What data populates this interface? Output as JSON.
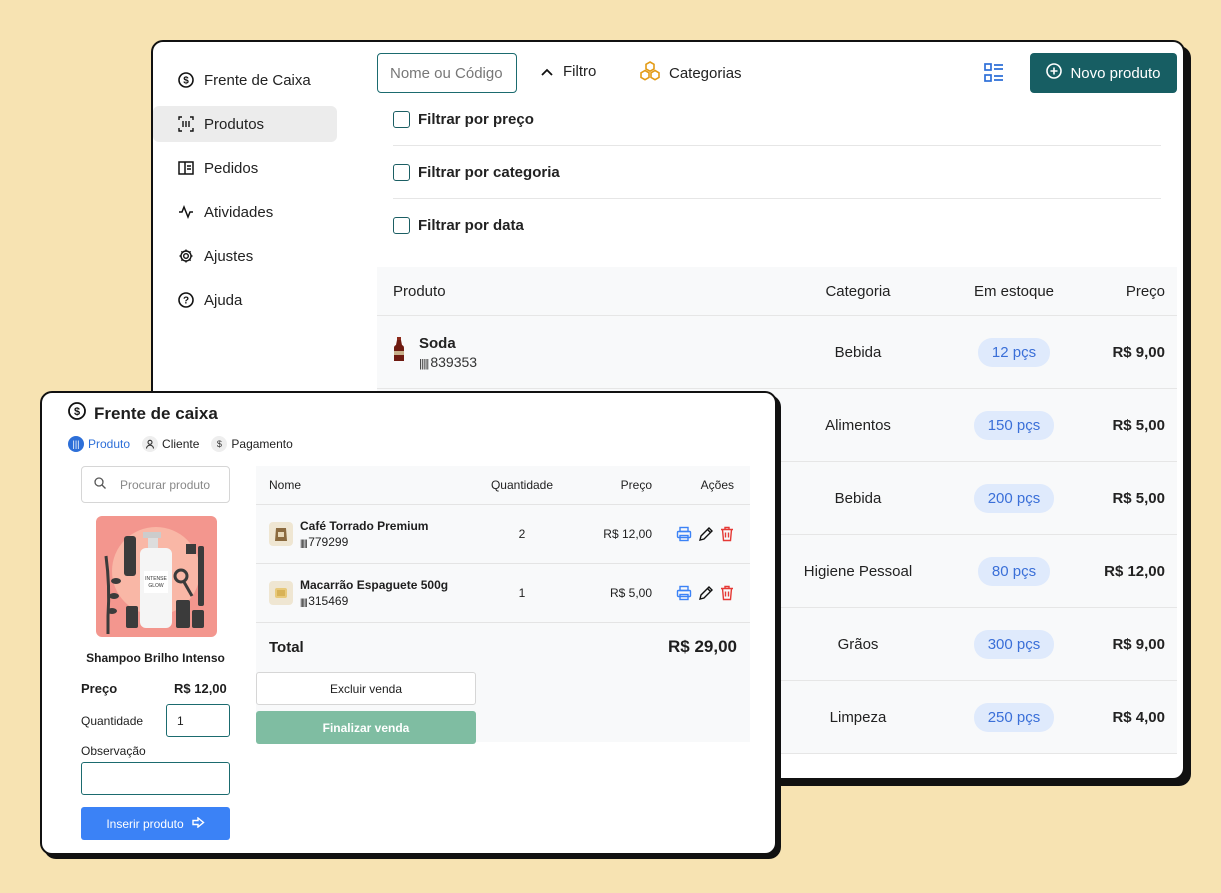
{
  "sidebar": {
    "items": [
      {
        "label": "Frente de Caixa",
        "icon": "dollar-circle-icon"
      },
      {
        "label": "Produtos",
        "icon": "barcode-scan-icon"
      },
      {
        "label": "Pedidos",
        "icon": "book-icon"
      },
      {
        "label": "Atividades",
        "icon": "activity-icon"
      },
      {
        "label": "Ajustes",
        "icon": "gear-icon"
      },
      {
        "label": "Ajuda",
        "icon": "help-circle-icon"
      }
    ],
    "active_index": 1
  },
  "toolbar": {
    "search_placeholder": "Nome ou Código",
    "filter_label": "Filtro",
    "categories_label": "Categorias",
    "new_product_label": "Novo produto"
  },
  "filters": [
    {
      "label": "Filtrar por preço"
    },
    {
      "label": "Filtrar por categoria"
    },
    {
      "label": "Filtrar por data"
    }
  ],
  "products_table": {
    "headers": {
      "product": "Produto",
      "category": "Categoria",
      "stock": "Em estoque",
      "price": "Preço"
    },
    "rows": [
      {
        "name": "Soda",
        "code": "839353",
        "category": "Bebida",
        "stock": "12 pçs",
        "price": "R$ 9,00"
      },
      {
        "category": "Alimentos",
        "stock": "150 pçs",
        "price": "R$ 5,00"
      },
      {
        "category": "Bebida",
        "stock": "200 pçs",
        "price": "R$ 5,00"
      },
      {
        "category": "Higiene Pessoal",
        "stock": "80 pçs",
        "price": "R$ 12,00"
      },
      {
        "category": "Grãos",
        "stock": "300 pçs",
        "price": "R$ 9,00"
      },
      {
        "category": "Limpeza",
        "stock": "250 pçs",
        "price": "R$ 4,00"
      }
    ]
  },
  "pos": {
    "title": "Frente de caixa",
    "steps": [
      {
        "label": "Produto",
        "icon": "barcode-icon",
        "active": true
      },
      {
        "label": "Cliente",
        "icon": "user-icon",
        "active": false
      },
      {
        "label": "Pagamento",
        "icon": "dollar-icon",
        "active": false
      }
    ],
    "search_placeholder": "Procurar produto",
    "selected_product": {
      "name": "Shampoo Brilho Intenso",
      "price_label": "Preço",
      "price": "R$ 12,00",
      "quantity_label": "Quantidade",
      "quantity": "1",
      "notes_label": "Observação",
      "notes": ""
    },
    "insert_label": "Inserir produto",
    "cart": {
      "headers": {
        "name": "Nome",
        "qty": "Quantidade",
        "price": "Preço",
        "actions": "Ações"
      },
      "items": [
        {
          "name": "Café Torrado Premium",
          "code": "779299",
          "qty": "2",
          "price": "R$ 12,00"
        },
        {
          "name": "Macarrão Espaguete 500g",
          "code": "315469",
          "qty": "1",
          "price": "R$ 5,00"
        }
      ],
      "total_label": "Total",
      "total_value": "R$ 29,00"
    },
    "delete_sale_label": "Excluir venda",
    "finish_sale_label": "Finalizar venda"
  },
  "colors": {
    "background": "#f7e3b2",
    "primary": "#175e63",
    "accent_blue": "#3b82f6",
    "finish_green": "#7fbda2",
    "stock_pill": "#dfeafc",
    "delete_red": "#e53935"
  }
}
